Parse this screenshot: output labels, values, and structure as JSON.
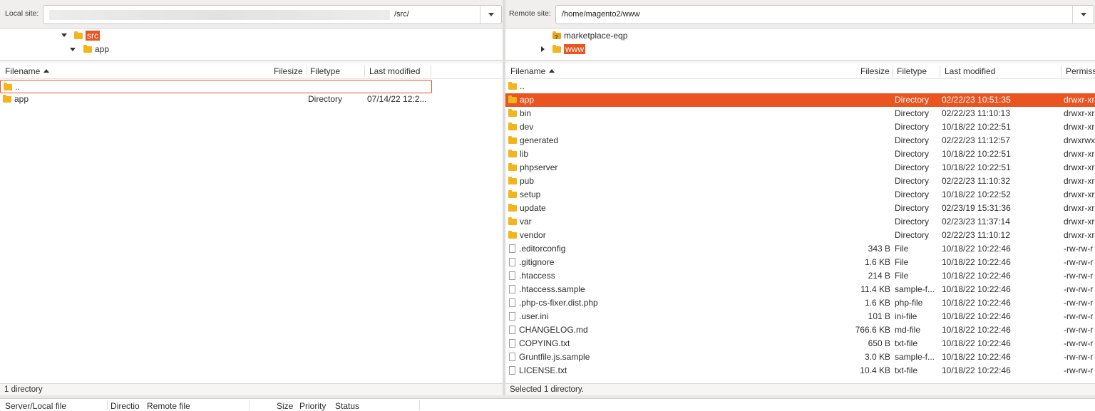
{
  "local": {
    "site_label": "Local site:",
    "path_suffix": "/src/",
    "tree": [
      {
        "label": "src",
        "expanded": true,
        "highlighted": true
      },
      {
        "label": "app",
        "expanded": true,
        "highlighted": false
      }
    ],
    "columns": [
      "Filename",
      "Filesize",
      "Filetype",
      "Last modified"
    ],
    "rows": [
      {
        "name": "..",
        "size": "",
        "type": "",
        "modified": "",
        "icon": "folder-icon"
      },
      {
        "name": "app",
        "size": "",
        "type": "Directory",
        "modified": "07/14/22 12:2...",
        "icon": "folder-icon"
      }
    ],
    "status": "1 directory"
  },
  "remote": {
    "site_label": "Remote site:",
    "path": "/home/magento2/www",
    "tree": [
      {
        "label": "marketplace-eqp",
        "unknown": true
      },
      {
        "label": "www",
        "highlighted": true
      }
    ],
    "columns": [
      "Filename",
      "Filesize",
      "Filetype",
      "Last modified",
      "Permiss"
    ],
    "rows": [
      {
        "name": "..",
        "size": "",
        "type": "",
        "modified": "",
        "perms": "",
        "icon": "folder-icon"
      },
      {
        "name": "app",
        "size": "",
        "type": "Directory",
        "modified": "02/22/23 10:51:35",
        "perms": "drwxr-xr",
        "icon": "folder-icon",
        "selected": true
      },
      {
        "name": "bin",
        "size": "",
        "type": "Directory",
        "modified": "02/22/23 11:10:13",
        "perms": "drwxr-xr",
        "icon": "folder-icon"
      },
      {
        "name": "dev",
        "size": "",
        "type": "Directory",
        "modified": "10/18/22 10:22:51",
        "perms": "drwxr-xr",
        "icon": "folder-icon"
      },
      {
        "name": "generated",
        "size": "",
        "type": "Directory",
        "modified": "02/22/23 11:12:57",
        "perms": "drwxrwx",
        "icon": "folder-icon"
      },
      {
        "name": "lib",
        "size": "",
        "type": "Directory",
        "modified": "10/18/22 10:22:51",
        "perms": "drwxr-xr",
        "icon": "folder-icon"
      },
      {
        "name": "phpserver",
        "size": "",
        "type": "Directory",
        "modified": "10/18/22 10:22:51",
        "perms": "drwxr-xr",
        "icon": "folder-icon"
      },
      {
        "name": "pub",
        "size": "",
        "type": "Directory",
        "modified": "02/22/23 11:10:32",
        "perms": "drwxr-xr",
        "icon": "folder-icon"
      },
      {
        "name": "setup",
        "size": "",
        "type": "Directory",
        "modified": "10/18/22 10:22:52",
        "perms": "drwxr-xr",
        "icon": "folder-icon"
      },
      {
        "name": "update",
        "size": "",
        "type": "Directory",
        "modified": "02/23/19 15:31:36",
        "perms": "drwxr-xr",
        "icon": "folder-icon"
      },
      {
        "name": "var",
        "size": "",
        "type": "Directory",
        "modified": "02/23/23 11:37:14",
        "perms": "drwxr-xr",
        "icon": "folder-icon"
      },
      {
        "name": "vendor",
        "size": "",
        "type": "Directory",
        "modified": "02/22/23 11:10:12",
        "perms": "drwxr-xr",
        "icon": "folder-icon"
      },
      {
        "name": ".editorconfig",
        "size": "343 B",
        "type": "File",
        "modified": "10/18/22 10:22:46",
        "perms": "-rw-rw-r",
        "icon": "file-icon"
      },
      {
        "name": ".gitignore",
        "size": "1.6 KB",
        "type": "File",
        "modified": "10/18/22 10:22:46",
        "perms": "-rw-rw-r",
        "icon": "file-icon"
      },
      {
        "name": ".htaccess",
        "size": "214 B",
        "type": "File",
        "modified": "10/18/22 10:22:46",
        "perms": "-rw-rw-r",
        "icon": "file-icon"
      },
      {
        "name": ".htaccess.sample",
        "size": "11.4 KB",
        "type": "sample-f...",
        "modified": "10/18/22 10:22:46",
        "perms": "-rw-rw-r",
        "icon": "file-icon"
      },
      {
        "name": ".php-cs-fixer.dist.php",
        "size": "1.6 KB",
        "type": "php-file",
        "modified": "10/18/22 10:22:46",
        "perms": "-rw-rw-r",
        "icon": "file-icon"
      },
      {
        "name": ".user.ini",
        "size": "101 B",
        "type": "ini-file",
        "modified": "10/18/22 10:22:46",
        "perms": "-rw-rw-r",
        "icon": "file-icon"
      },
      {
        "name": "CHANGELOG.md",
        "size": "766.6 KB",
        "type": "md-file",
        "modified": "10/18/22 10:22:46",
        "perms": "-rw-rw-r",
        "icon": "file-icon"
      },
      {
        "name": "COPYING.txt",
        "size": "650 B",
        "type": "txt-file",
        "modified": "10/18/22 10:22:46",
        "perms": "-rw-rw-r",
        "icon": "file-icon"
      },
      {
        "name": "Gruntfile.js.sample",
        "size": "3.0 KB",
        "type": "sample-f...",
        "modified": "10/18/22 10:22:46",
        "perms": "-rw-rw-r",
        "icon": "file-icon"
      },
      {
        "name": "LICENSE.txt",
        "size": "10.4 KB",
        "type": "txt-file",
        "modified": "10/18/22 10:22:46",
        "perms": "-rw-rw-r",
        "icon": "file-icon"
      }
    ],
    "status": "Selected 1 directory."
  },
  "queue": {
    "columns": [
      "Server/Local file",
      "Directio",
      "Remote file",
      "Size",
      "Priority",
      "Status"
    ]
  },
  "colors": {
    "accent": "#e95420",
    "folder": "#f3b51b"
  }
}
